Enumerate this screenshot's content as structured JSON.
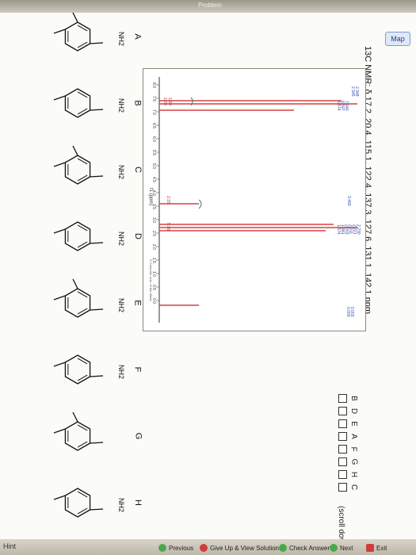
{
  "window": {
    "title": "Problem"
  },
  "map_button": "Map",
  "question": "13C NMR: δ 17.2, 20.4, 115.1, 122.4, 137.3, 127.6, 131.1, 142.1 ppm",
  "spectrum": {
    "peak_labels_top": [
      "2.348",
      "2.345"
    ],
    "peak_labels_mid": [
      "7.940",
      "6.597",
      "6.574"
    ],
    "integrals": [
      "1.99",
      "1.00"
    ],
    "peak_labels_3": [
      "3.460"
    ],
    "integral_3": "2.15",
    "peak_labels_4": [
      "2.230",
      "2.221",
      "2.211",
      "2.003",
      "1.981",
      "1.574"
    ],
    "integral_4": "5.99",
    "peak_labels_tms": [
      "0.003",
      "0.000"
    ],
    "xaxis_ticks": [
      "8.0",
      "7.5",
      "7.0",
      "6.5",
      "6.0",
      "5.5",
      "5.0",
      "4.5",
      "4.0",
      "3.5",
      "3.0",
      "2.5",
      "2.0",
      "1.5",
      "1.0",
      "0.5",
      "0.0"
    ],
    "xlabel": "f1 (ppm)",
    "footer_text": "© Colorado Univ. of the Mines"
  },
  "answers": {
    "options": [
      "B",
      "D",
      "E",
      "A",
      "F",
      "G",
      "H",
      "C"
    ],
    "scroll_note": "(scroll down)"
  },
  "molecules": [
    {
      "letter": "A",
      "substituent": "NH2"
    },
    {
      "letter": "B",
      "substituent": "NH2"
    },
    {
      "letter": "C",
      "substituent": "NH2"
    },
    {
      "letter": "D",
      "substituent": "NH2"
    },
    {
      "letter": "E",
      "substituent": "NH2"
    },
    {
      "letter": "F",
      "substituent": "NH2"
    },
    {
      "letter": "G",
      "substituent": ""
    },
    {
      "letter": "H",
      "substituent": "NH2"
    }
  ],
  "footer": {
    "hint": "Hint",
    "previous": "Previous",
    "give_up": "Give Up & View Solution",
    "check": "Check Answer",
    "next": "Next",
    "exit": "Exit"
  }
}
